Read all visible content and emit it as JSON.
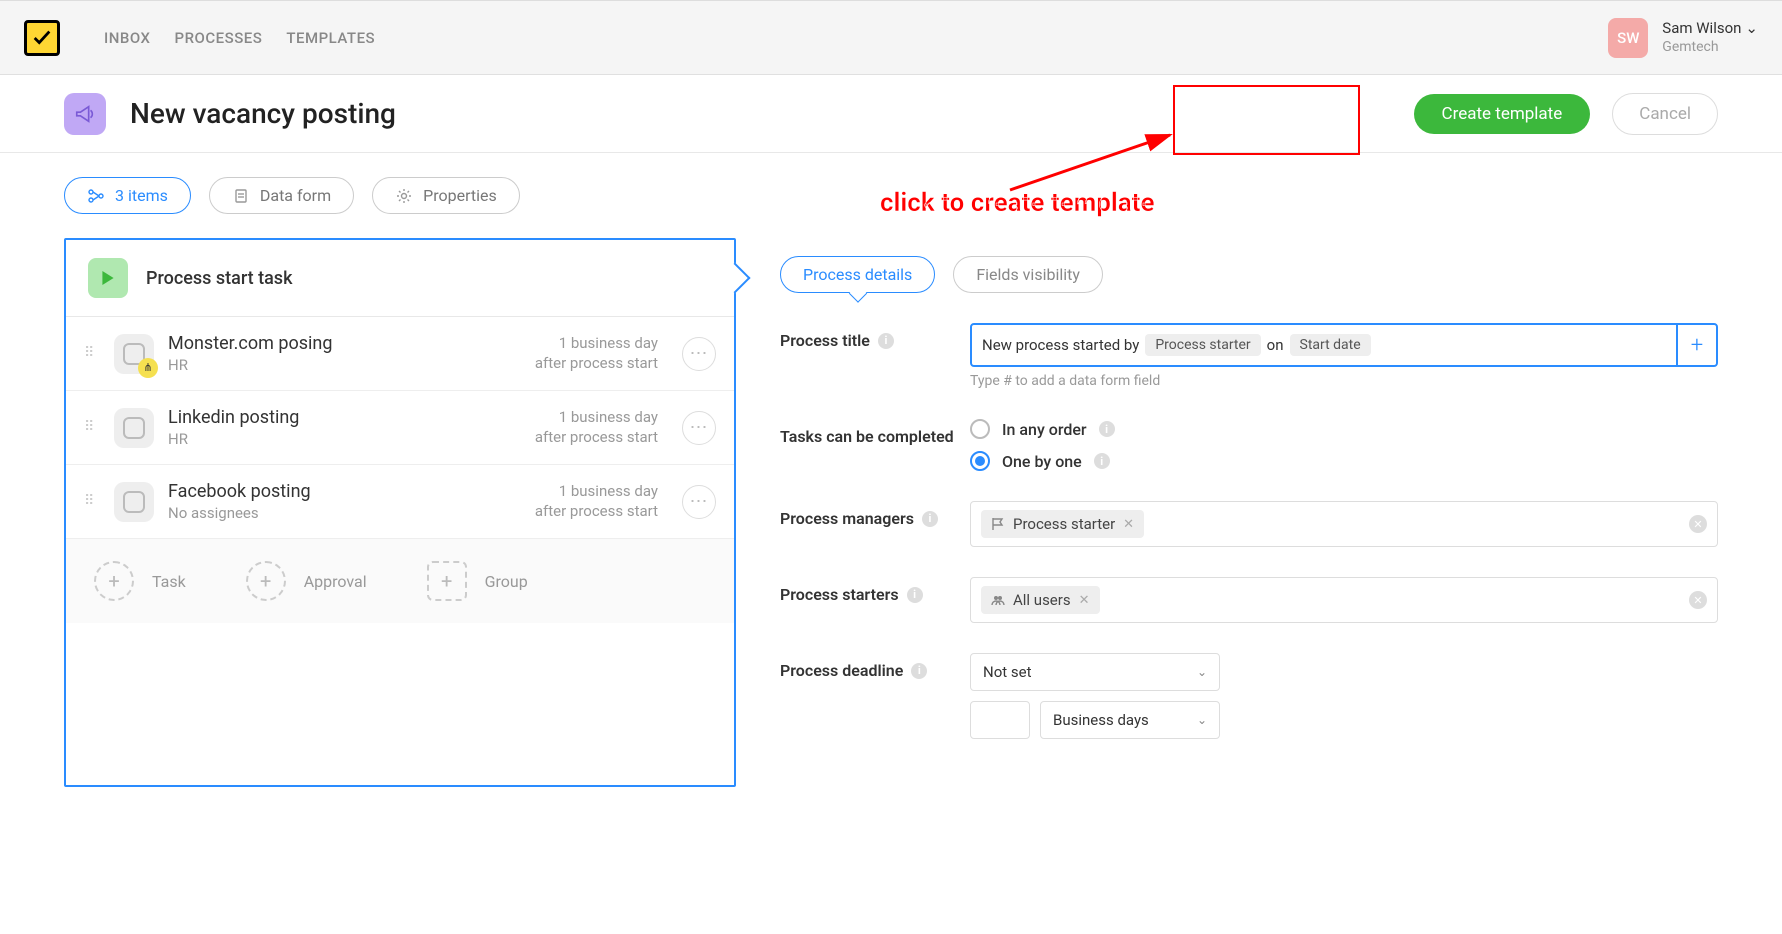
{
  "nav": {
    "inbox": "INBOX",
    "processes": "PROCESSES",
    "templates": "TEMPLATES"
  },
  "user": {
    "initials": "SW",
    "name": "Sam Wilson",
    "company": "Gemtech"
  },
  "page": {
    "title": "New vacancy posting",
    "create": "Create template",
    "cancel": "Cancel"
  },
  "annotation": "click to create template",
  "tabs": {
    "items": "3 items",
    "dataform": "Data form",
    "properties": "Properties"
  },
  "start_task": "Process start task",
  "tasks": [
    {
      "title": "Monster.com posing",
      "sub": "HR",
      "due1": "1 business day",
      "due2": "after process start",
      "shared": true
    },
    {
      "title": "Linkedin posting",
      "sub": "HR",
      "due1": "1 business day",
      "due2": "after process start",
      "shared": false
    },
    {
      "title": "Facebook posting",
      "sub": "No assignees",
      "due1": "1 business day",
      "due2": "after process start",
      "shared": false
    }
  ],
  "add": {
    "task": "Task",
    "approval": "Approval",
    "group": "Group"
  },
  "detail_tabs": {
    "details": "Process details",
    "visibility": "Fields visibility"
  },
  "form": {
    "title_label": "Process title",
    "title_prefix": "New process started by",
    "title_var1": "Process starter",
    "title_mid": "on",
    "title_var2": "Start date",
    "title_hint": "Type # to add a data form field",
    "complete_label": "Tasks can be completed",
    "complete_any": "In any order",
    "complete_one": "One by one",
    "managers_label": "Process managers",
    "managers_tag": "Process starter",
    "starters_label": "Process starters",
    "starters_tag": "All users",
    "deadline_label": "Process deadline",
    "deadline_select": "Not set",
    "deadline_unit": "Business days"
  }
}
